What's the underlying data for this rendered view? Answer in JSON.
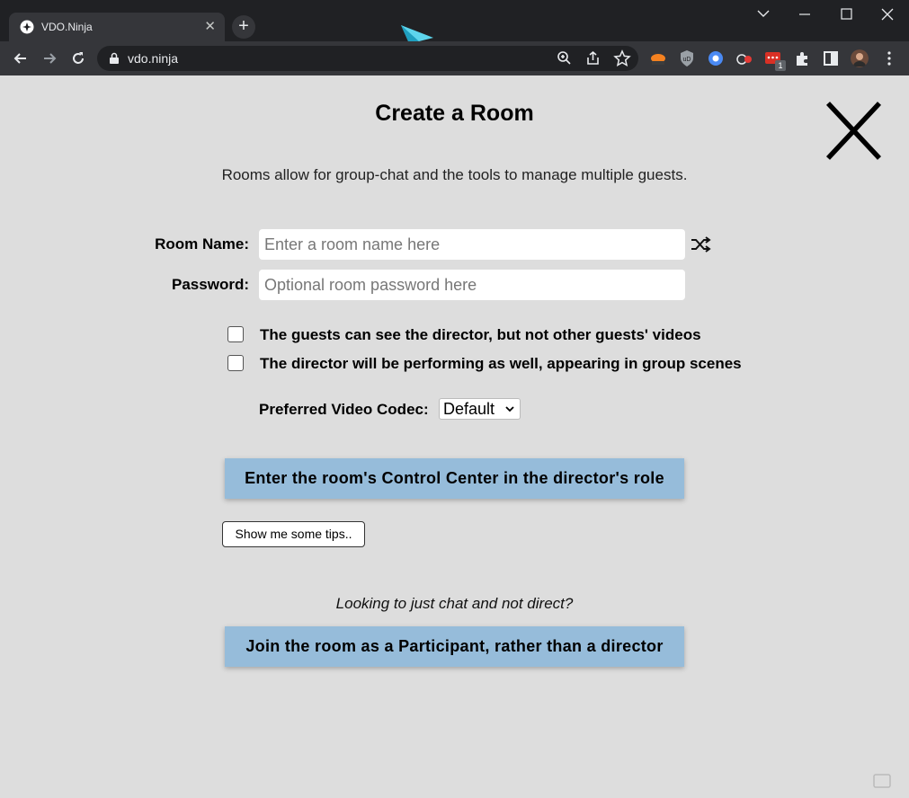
{
  "browser": {
    "tab_title": "VDO.Ninja",
    "tab_close": "✕",
    "new_tab": "+",
    "url": "vdo.ninja",
    "notification_badge": "1"
  },
  "icons": {
    "favicon": "vdo-ninja-icon",
    "window": [
      "chevron-down-icon",
      "minimize-icon",
      "maximize-icon",
      "close-icon"
    ],
    "toolbar": [
      "back-icon",
      "forward-icon",
      "reload-icon",
      "lock-icon",
      "zoom-icon",
      "share-icon",
      "star-icon"
    ],
    "extensions": [
      "cloudflare-icon",
      "ublock-icon",
      "chrome-icon",
      "recorder-icon",
      "red-extension-icon",
      "puzzle-icon",
      "sidebar-icon",
      "profile-avatar"
    ]
  },
  "page": {
    "title": "Create a Room",
    "description": "Rooms allow for group-chat and the tools to manage multiple guests.",
    "room_name_label": "Room Name:",
    "room_name_placeholder": "Enter a room name here",
    "password_label": "Password:",
    "password_placeholder": "Optional room password here",
    "checkbox_1": "The guests can see the director, but not other guests' videos",
    "checkbox_2": "The director will be performing as well, appearing in group scenes",
    "codec_label": "Preferred Video Codec:",
    "codec_value": "Default",
    "director_button": "Enter the room's Control Center in the director's role",
    "tips_button": "Show me some tips..",
    "chat_question": "Looking to just chat and not direct?",
    "participant_button": "Join the room as a Participant, rather than a director"
  },
  "colors": {
    "page_bg": "#dddddd",
    "button_bg": "#96bcda",
    "chrome_dark": "#202124",
    "chrome_toolbar": "#35363a"
  }
}
